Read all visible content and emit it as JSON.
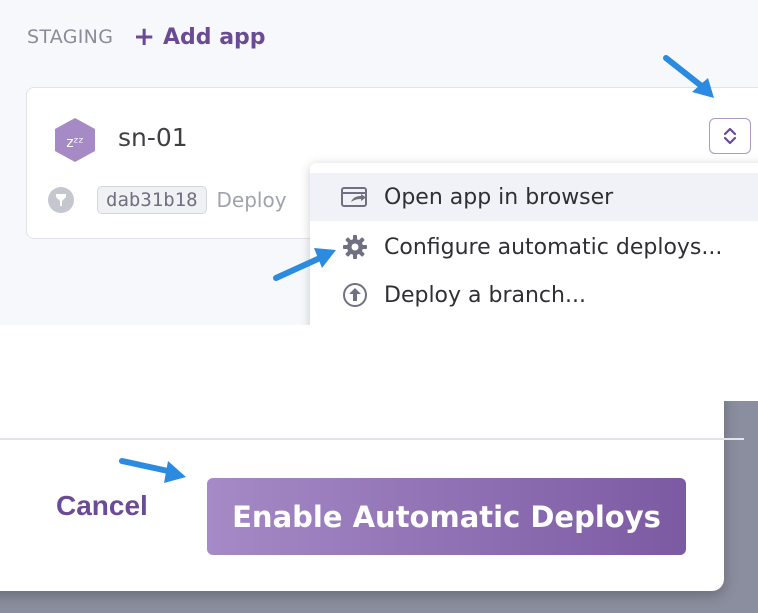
{
  "stage": {
    "title": "STAGING",
    "add_app_label": "Add app",
    "add_app_symbol": "+"
  },
  "app": {
    "name": "sn-01",
    "icon": "sleeping-dyno-icon",
    "icon_text": "zᶻᶻ",
    "icon_color": "#a58ac6",
    "commit_hash": "dab31b18",
    "deploy_text": "Deploy"
  },
  "menu": {
    "items": [
      {
        "label": "Open app in browser",
        "icon": "external-window-icon"
      },
      {
        "label": "Configure automatic deploys...",
        "icon": "gear-icon"
      },
      {
        "label": "Deploy a branch...",
        "icon": "upload-icon"
      }
    ]
  },
  "modal": {
    "cancel_label": "Cancel",
    "enable_label": "Enable Automatic Deploys"
  },
  "colors": {
    "accent": "#6b4a96",
    "button_gradient_start": "#a58ac6",
    "button_gradient_end": "#7c5aa3",
    "annotation_arrow": "#2b8be0"
  }
}
